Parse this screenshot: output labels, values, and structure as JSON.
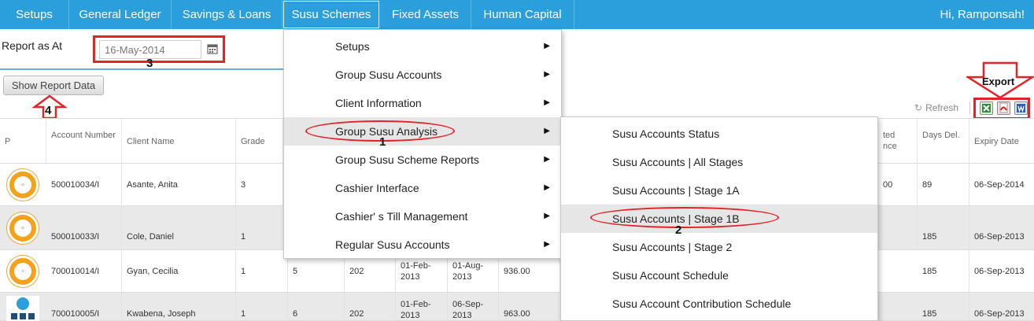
{
  "nav": {
    "items": [
      "Setups",
      "General Ledger",
      "Savings & Loans",
      "Susu Schemes",
      "Fixed Assets",
      "Human Capital"
    ],
    "greeting": "Hi, Ramponsah!"
  },
  "report": {
    "label": "Report as At",
    "date_value": "16-May-2014",
    "show_button": "Show Report Data"
  },
  "annotations": {
    "n1": "1",
    "n2": "2",
    "n3": "3",
    "n4": "4",
    "export": "Export"
  },
  "toolbar": {
    "refresh": "Refresh"
  },
  "table": {
    "headers": {
      "p": "P",
      "account_number": "Account Number",
      "client_name": "Client Name",
      "grade": "Grade",
      "balance_partial": "ted\nnce",
      "days_del": "Days Del.",
      "expiry_date": "Expiry Date"
    },
    "rows": [
      {
        "account": "500010034/I",
        "name": "Asante, Anita",
        "grade": "3",
        "c5": "",
        "c6": "",
        "c7": "",
        "c8": "",
        "c9": "",
        "balance": "00",
        "days": "89",
        "expiry": "06-Sep-2014"
      },
      {
        "account": "500010033/I",
        "name": "Cole, Daniel",
        "grade": "1",
        "c5": "",
        "c6": "",
        "c7": "",
        "c8": "",
        "c9": "",
        "balance": "",
        "days": "185",
        "expiry": "06-Sep-2013"
      },
      {
        "account": "700010014/I",
        "name": "Gyan, Cecilia",
        "grade": "1",
        "c5": "5",
        "c6": "202",
        "c7": "01-Feb-2013",
        "c8": "01-Aug-2013",
        "c9": "936.00",
        "balance": "",
        "days": "185",
        "expiry": "06-Sep-2013"
      },
      {
        "account": "700010005/I",
        "name": "Kwabena, Joseph",
        "grade": "1",
        "c5": "6",
        "c6": "202",
        "c7": "01-Feb-2013",
        "c8": "06-Sep-2013",
        "c9": "963.00",
        "balance": "",
        "days": "185",
        "expiry": "06-Sep-2013"
      }
    ]
  },
  "menu": {
    "items": [
      "Setups",
      "Group Susu Accounts",
      "Client Information",
      "Group Susu Analysis",
      "Group Susu Scheme Reports",
      "Cashier Interface",
      "Cashier' s Till Management",
      "Regular Susu Accounts"
    ],
    "arrow": "▶"
  },
  "submenu": {
    "items": [
      "Susu Accounts Status",
      "Susu Accounts | All Stages",
      "Susu Accounts | Stage 1A",
      "Susu Accounts | Stage 1B",
      "Susu Accounts | Stage 2",
      "Susu Account Schedule",
      "Susu Account Contribution Schedule"
    ]
  },
  "colors": {
    "nav_bg": "#2a9fdb",
    "annotation_red": "#e0252a",
    "highlight": "#e6e6e6"
  }
}
